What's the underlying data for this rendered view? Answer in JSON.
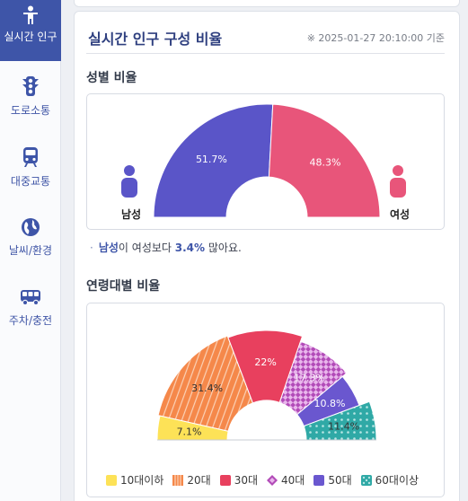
{
  "sidebar": {
    "items": [
      {
        "label": "실시간 인구",
        "icon": "person-icon",
        "active": true
      },
      {
        "label": "도로소통",
        "icon": "traffic-light-icon",
        "active": false
      },
      {
        "label": "대중교통",
        "icon": "subway-icon",
        "active": false
      },
      {
        "label": "날씨/환경",
        "icon": "globe-icon",
        "active": false
      },
      {
        "label": "주차/충전",
        "icon": "bus-icon",
        "active": false
      }
    ]
  },
  "header": {
    "title": "실시간 인구 구성 비율",
    "timestamp": "※ 2025-01-27 20:10:00 기준"
  },
  "gender_section": {
    "title": "성별 비율",
    "male_label": "남성",
    "female_label": "여성",
    "note_subject": "남성",
    "note_mid": "이 여성보다 ",
    "note_value": "3.4%",
    "note_tail": " 많아요."
  },
  "age_section": {
    "title": "연령대별 비율"
  },
  "colors": {
    "male": "#5a55c8",
    "female": "#e8557a",
    "age_10": "#fde257",
    "age_20": "#f5884a",
    "age_30": "#e8405e",
    "age_40": "#b24bb8",
    "age_50": "#6a57cf",
    "age_60": "#2fa9a6",
    "accent": "#3e55a8"
  },
  "chart_data": [
    {
      "type": "pie",
      "variant": "half-donut",
      "categories": [
        "남성",
        "여성"
      ],
      "values": [
        51.7,
        48.3
      ],
      "labels": [
        "51.7%",
        "48.3%"
      ]
    },
    {
      "type": "pie",
      "variant": "half-donut",
      "categories": [
        "10대이하",
        "20대",
        "30대",
        "40대",
        "50대",
        "60대이상"
      ],
      "values": [
        7.1,
        31.4,
        22,
        17.3,
        10.8,
        11.4
      ],
      "labels": [
        "7.1%",
        "31.4%",
        "22%",
        "17.3%",
        "10.8%",
        "11.4%"
      ],
      "legend": [
        "10대이하",
        "20대",
        "30대",
        "40대",
        "50대",
        "60대이상"
      ]
    }
  ]
}
